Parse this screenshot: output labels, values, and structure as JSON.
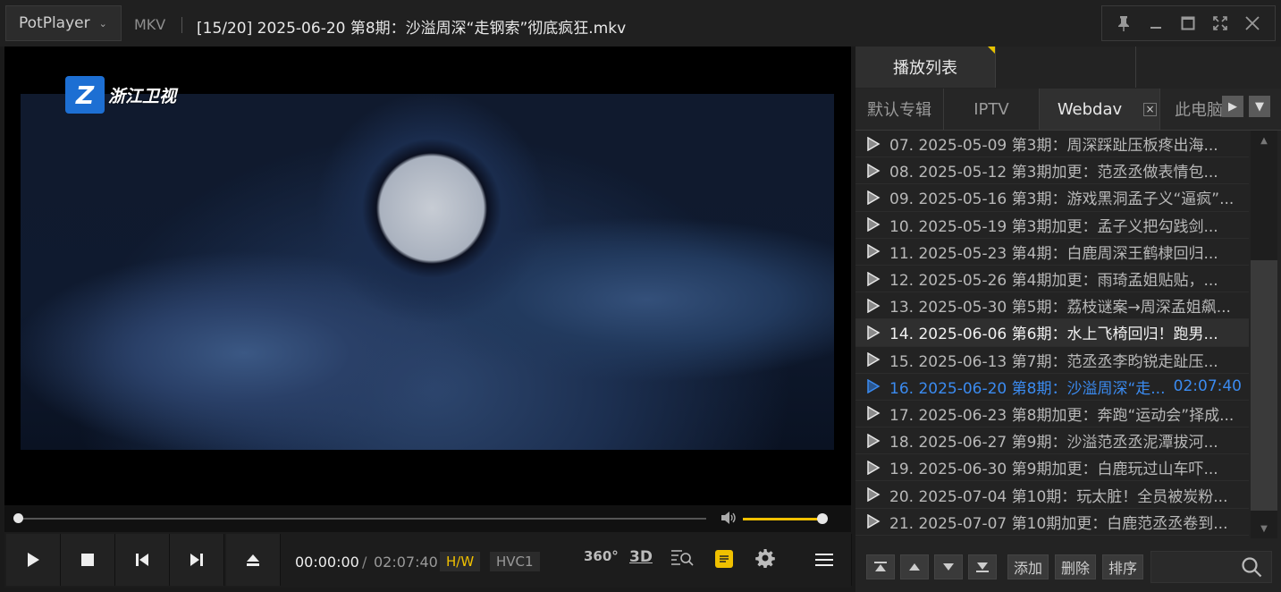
{
  "app": {
    "name": "PotPlayer",
    "format": "MKV",
    "title": "[15/20] 2025-06-20 第8期：沙溢周深“走钢索”彻底疯狂.mkv"
  },
  "video": {
    "station_logo": "Z",
    "station_name": "浙江卫视"
  },
  "playback": {
    "progress": 0.0,
    "volume": 0.97,
    "current_time": "00:00:00",
    "time_separator": "/",
    "total_time": "02:07:40",
    "hw_badge": "H/W",
    "codec_badge": "HVC1",
    "icon_360": "360°",
    "icon_3d": "3D"
  },
  "colors": {
    "accent_yellow": "#f0c000",
    "playing_blue": "#3b8bf0"
  },
  "playlist": {
    "main_tab": "播放列表",
    "tabs": [
      "默认专辑",
      "IPTV",
      "Webdav",
      "此电脑"
    ],
    "tab_close": "×",
    "items": [
      {
        "text": "07. 2025-05-09 第3期：周深踩趾压板疼出海...",
        "dur": ""
      },
      {
        "text": "08. 2025-05-12 第3期加更：范丞丞做表情包...",
        "dur": ""
      },
      {
        "text": "09. 2025-05-16 第3期：游戏黑洞孟子义“逼疯”...",
        "dur": ""
      },
      {
        "text": "10. 2025-05-19 第3期加更：孟子义把勾践剑...",
        "dur": ""
      },
      {
        "text": "11. 2025-05-23 第4期：白鹿周深王鹤棣回归...",
        "dur": ""
      },
      {
        "text": "12. 2025-05-26 第4期加更：雨琦孟姐贴贴，...",
        "dur": ""
      },
      {
        "text": "13. 2025-05-30 第5期：荔枝谜案→周深孟姐飙...",
        "dur": ""
      },
      {
        "text": "14. 2025-06-06 第6期：水上飞椅回归！跑男...",
        "dur": ""
      },
      {
        "text": "15. 2025-06-13 第7期：范丞丞李昀锐走趾压...",
        "dur": ""
      },
      {
        "text": "16. 2025-06-20 第8期：沙溢周深“走...",
        "dur": "02:07:40"
      },
      {
        "text": "17. 2025-06-23 第8期加更：奔跑“运动会”择成...",
        "dur": ""
      },
      {
        "text": "18. 2025-06-27 第9期：沙溢范丞丞泥潭拔河...",
        "dur": ""
      },
      {
        "text": "19. 2025-06-30 第9期加更：白鹿玩过山车吓...",
        "dur": ""
      },
      {
        "text": "20. 2025-07-04 第10期：玩太脏！全员被炭粉...",
        "dur": ""
      },
      {
        "text": "21. 2025-07-07 第10期加更：白鹿范丞丞卷到...",
        "dur": ""
      }
    ],
    "footer": {
      "add": "添加",
      "delete": "删除",
      "sort": "排序"
    }
  }
}
